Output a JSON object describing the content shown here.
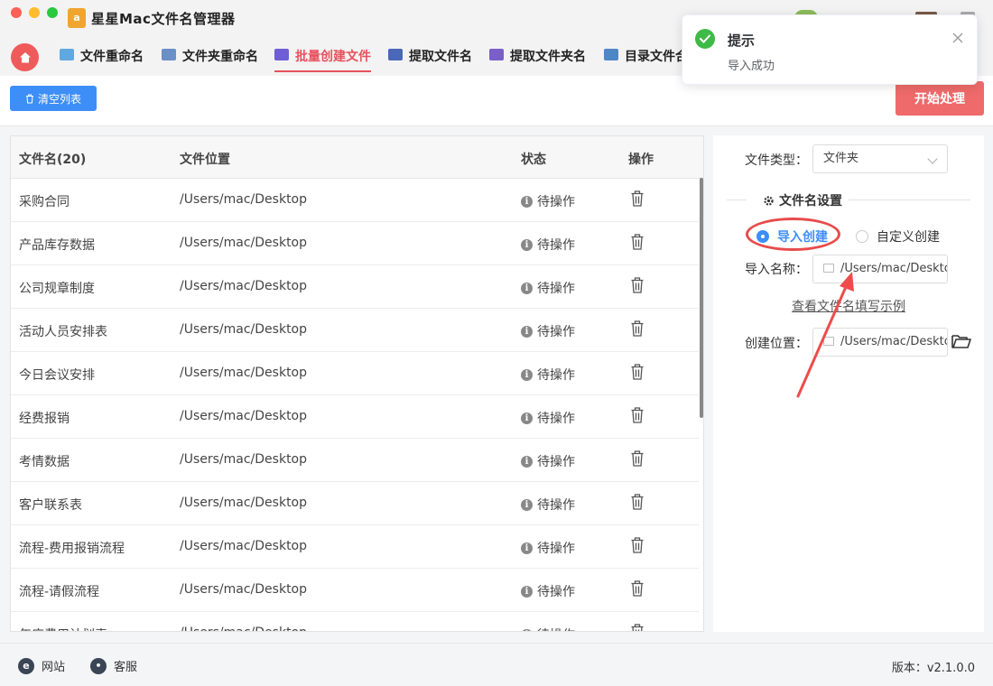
{
  "app": {
    "title": "星星Mac文件名管理器",
    "logo_text": "b a"
  },
  "tabs": [
    {
      "label": "文件重命名",
      "color": "#5fa8e0"
    },
    {
      "label": "文件夹重命名",
      "color": "#6b8fc7"
    },
    {
      "label": "批量创建文件",
      "color": "#6e5fd6"
    },
    {
      "label": "提取文件名",
      "color": "#4a67b8"
    },
    {
      "label": "提取文件夹名",
      "color": "#7a5fc9"
    },
    {
      "label": "目录文件合",
      "color": "#4f86c6"
    }
  ],
  "active_tab_index": 2,
  "toolbar": {
    "clear_label": "清空列表",
    "start_label": "开始处理"
  },
  "table": {
    "headers": [
      "文件名(20)",
      "文件位置",
      "状态",
      "操作"
    ],
    "rows": [
      {
        "name": "采购合同",
        "path": "/Users/mac/Desktop",
        "status": "待操作"
      },
      {
        "name": "产品库存数据",
        "path": "/Users/mac/Desktop",
        "status": "待操作"
      },
      {
        "name": "公司规章制度",
        "path": "/Users/mac/Desktop",
        "status": "待操作"
      },
      {
        "name": "活动人员安排表",
        "path": "/Users/mac/Desktop",
        "status": "待操作"
      },
      {
        "name": "今日会议安排",
        "path": "/Users/mac/Desktop",
        "status": "待操作"
      },
      {
        "name": "经费报销",
        "path": "/Users/mac/Desktop",
        "status": "待操作"
      },
      {
        "name": "考情数据",
        "path": "/Users/mac/Desktop",
        "status": "待操作"
      },
      {
        "name": "客户联系表",
        "path": "/Users/mac/Desktop",
        "status": "待操作"
      },
      {
        "name": "流程-费用报销流程",
        "path": "/Users/mac/Desktop",
        "status": "待操作"
      },
      {
        "name": "流程-请假流程",
        "path": "/Users/mac/Desktop",
        "status": "待操作"
      },
      {
        "name": "年度费用计划表",
        "path": "/Users/mac/Desktop",
        "status": "待操作"
      }
    ]
  },
  "settings": {
    "file_type_label": "文件类型：",
    "file_type_value": "文件夹",
    "section_title": "文件名设置",
    "radio_import": "导入创建",
    "radio_custom": "自定义创建",
    "import_name_label": "导入名称：",
    "import_name_value": "/Users/mac/Desktop",
    "example_link": "查看文件名填写示例",
    "create_location_label": "创建位置：",
    "create_location_value": "/Users/mac/Desktop"
  },
  "toast": {
    "title": "提示",
    "message": "导入成功"
  },
  "footer": {
    "website": "网站",
    "service": "客服",
    "version": "版本：v2.1.0.0"
  },
  "colors": {
    "accent_red": "#e8515c",
    "primary_blue": "#3e8ef7",
    "success_green": "#3fba49"
  }
}
